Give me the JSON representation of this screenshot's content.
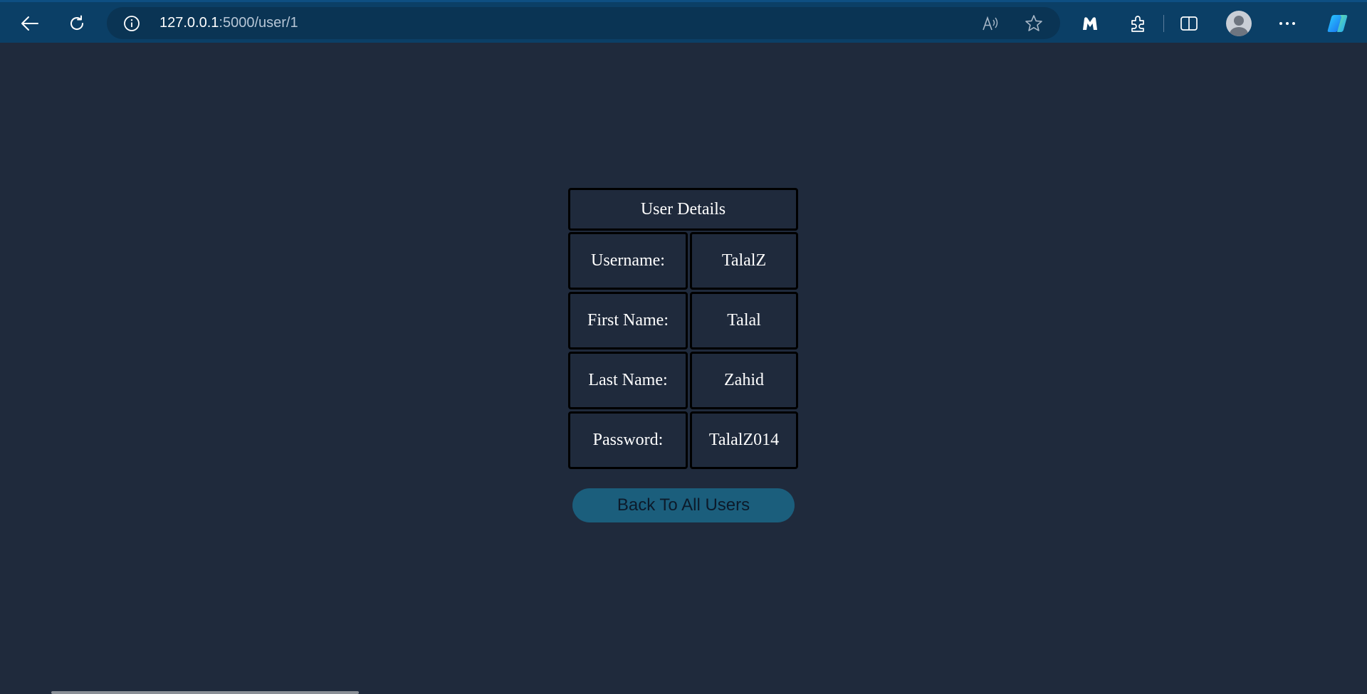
{
  "browser": {
    "url_host": "127.0.0.1",
    "url_rest": ":5000/user/1",
    "colors": {
      "toolbar": "#0b3f66",
      "address_bar": "#0a3454"
    },
    "icons": [
      "back-arrow-icon",
      "refresh-icon",
      "site-info-icon",
      "read-aloud-icon",
      "favorite-star-icon",
      "malwarebytes-icon",
      "extensions-icon",
      "split-screen-icon",
      "profile-icon",
      "more-icon",
      "copilot-icon"
    ]
  },
  "user_details": {
    "title": "User Details",
    "rows": [
      {
        "label": "Username:",
        "value": "TalalZ"
      },
      {
        "label": "First Name:",
        "value": "Talal"
      },
      {
        "label": "Last Name:",
        "value": "Zahid"
      },
      {
        "label": "Password:",
        "value": "TalalZ014"
      }
    ]
  },
  "back_button": {
    "label": "Back To All Users",
    "color": "#1b5e7c"
  },
  "page": {
    "background": "#1f2a3c"
  }
}
